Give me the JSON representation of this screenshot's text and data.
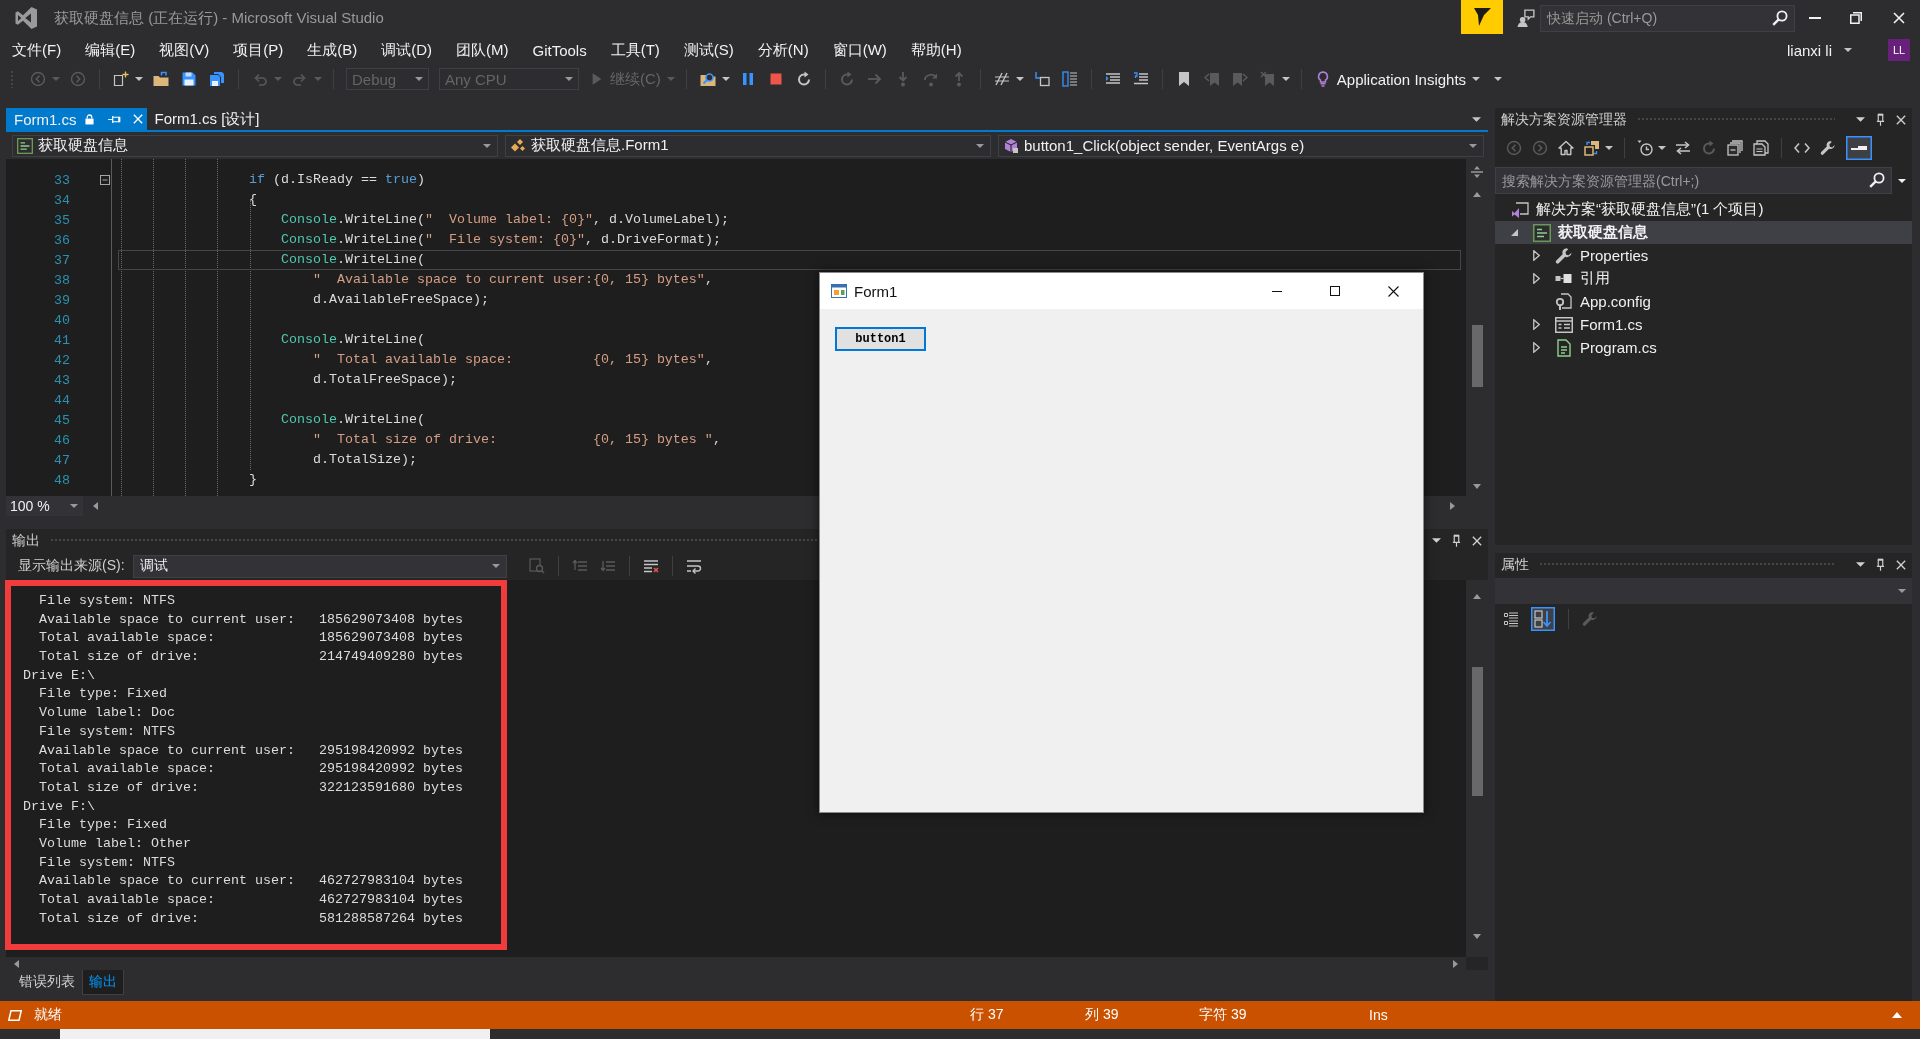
{
  "title_bar": {
    "title": "获取硬盘信息 (正在运行) - Microsoft Visual Studio",
    "quick_launch": {
      "placeholder": "快速启动 (Ctrl+Q)"
    }
  },
  "menu": [
    "文件(F)",
    "编辑(E)",
    "视图(V)",
    "项目(P)",
    "生成(B)",
    "调试(D)",
    "团队(M)",
    "GitTools",
    "工具(T)",
    "测试(S)",
    "分析(N)",
    "窗口(W)",
    "帮助(H)"
  ],
  "account": {
    "name": "lianxi li",
    "initials": "LL"
  },
  "toolbar": {
    "configuration": {
      "value": "Debug",
      "disabled": true
    },
    "platform": {
      "value": "Any CPU",
      "disabled": true
    },
    "continue": {
      "label": "继续(C)",
      "disabled": true
    },
    "insights": {
      "label": "Application Insights"
    }
  },
  "editor": {
    "tabs": [
      {
        "label": "Form1.cs",
        "selected": true
      },
      {
        "label": "Form1.cs [设计]",
        "selected": false
      }
    ],
    "navigation": [
      {
        "kind": "project",
        "label": "获取硬盘信息"
      },
      {
        "kind": "class",
        "label": "获取硬盘信息.Form1"
      },
      {
        "kind": "method",
        "label": "button1_Click(object sender, EventArgs e)"
      }
    ],
    "lines": [
      {
        "number": "33",
        "current": false,
        "folded": false,
        "tokens": [
          {
            "kind": "keyword",
            "text": "if"
          },
          {
            "kind": "plain",
            "text": " (d.IsReady == "
          },
          {
            "kind": "keyword",
            "text": "true"
          },
          {
            "kind": "plain",
            "text": ")"
          }
        ]
      },
      {
        "number": "34",
        "current": false,
        "tokens": [
          {
            "kind": "plain",
            "text": "{"
          }
        ],
        "children": [
          {
            "number": "35",
            "current": false,
            "tokens": [
              {
                "kind": "type",
                "text": "Console"
              },
              {
                "kind": "plain",
                "text": ".WriteLine("
              },
              {
                "kind": "string",
                "text": "\"  Volume label: {0}\""
              },
              {
                "kind": "plain",
                "text": ", d.VolumeLabel);"
              }
            ]
          },
          {
            "number": "36",
            "current": false,
            "tokens": [
              {
                "kind": "type",
                "text": "Console"
              },
              {
                "kind": "plain",
                "text": ".WriteLine("
              },
              {
                "kind": "string",
                "text": "\"  File system: {0}\""
              },
              {
                "kind": "plain",
                "text": ", d.DriveFormat);"
              }
            ]
          },
          {
            "number": "37",
            "current": true,
            "tokens": [
              {
                "kind": "type",
                "text": "Console"
              },
              {
                "kind": "plain",
                "text": ".WriteLine("
              }
            ],
            "children": [
              {
                "number": "38",
                "current": false,
                "tokens": [
                  {
                    "kind": "string",
                    "text": "\"  Available space to current user:{0, 15} bytes\""
                  },
                  {
                    "kind": "plain",
                    "text": ","
                  }
                ]
              },
              {
                "number": "39",
                "current": false,
                "tokens": [
                  {
                    "kind": "plain",
                    "text": "d.AvailableFreeSpace);"
                  }
                ]
              }
            ]
          },
          {
            "number": "40",
            "current": false
          },
          {
            "number": "41",
            "current": false,
            "tokens": [
              {
                "kind": "type",
                "text": "Console"
              },
              {
                "kind": "plain",
                "text": ".WriteLine("
              }
            ],
            "children": [
              {
                "number": "42",
                "current": false,
                "tokens": [
                  {
                    "kind": "string",
                    "text": "\"  Total available space:          {0, 15} bytes\""
                  },
                  {
                    "kind": "plain",
                    "text": ","
                  }
                ]
              },
              {
                "number": "43",
                "current": false,
                "tokens": [
                  {
                    "kind": "plain",
                    "text": "d.TotalFreeSpace);"
                  }
                ]
              }
            ]
          },
          {
            "number": "44",
            "current": false
          },
          {
            "number": "45",
            "current": false,
            "tokens": [
              {
                "kind": "type",
                "text": "Console"
              },
              {
                "kind": "plain",
                "text": ".WriteLine("
              }
            ],
            "children": [
              {
                "number": "46",
                "current": false,
                "tokens": [
                  {
                    "kind": "string",
                    "text": "\"  Total size of drive:            {0, 15} bytes \""
                  },
                  {
                    "kind": "plain",
                    "text": ","
                  }
                ]
              },
              {
                "number": "47",
                "current": false,
                "tokens": [
                  {
                    "kind": "plain",
                    "text": "d.TotalSize);"
                  }
                ]
              }
            ]
          }
        ]
      },
      {
        "number": "48",
        "current": false,
        "tokens": [
          {
            "kind": "plain",
            "text": "}"
          }
        ]
      }
    ],
    "zoom": "100 %"
  },
  "output": {
    "title": "输出",
    "source_label": "显示输出来源(S):",
    "source": "调试",
    "lines": [
      "  File system: NTFS",
      "  Available space to current user:   185629073408 bytes",
      "  Total available space:             185629073408 bytes",
      "  Total size of drive:               214749409280 bytes",
      "Drive E:\\",
      "  File type: Fixed",
      "  Volume label: Doc",
      "  File system: NTFS",
      "  Available space to current user:   295198420992 bytes",
      "  Total available space:             295198420992 bytes",
      "  Total size of drive:               322123591680 bytes",
      "Drive F:\\",
      "  File type: Fixed",
      "  Volume label: Other",
      "  File system: NTFS",
      "  Available space to current user:   462727983104 bytes",
      "  Total available space:             462727983104 bytes",
      "  Total size of drive:               581288587264 bytes"
    ]
  },
  "bottom_tabs": [
    {
      "label": "错误列表",
      "selected": false
    },
    {
      "label": "输出",
      "selected": true
    }
  ],
  "solution_explorer": {
    "title": "解决方案资源管理器",
    "search": {
      "placeholder": "搜索解决方案资源管理器(Ctrl+;)"
    },
    "tree": [
      {
        "label": "解决方案“获取硬盘信息”(1 个项目)",
        "kind": "solution",
        "expandable": false,
        "selected": false,
        "children": [
          {
            "label": "获取硬盘信息",
            "kind": "project",
            "expandable": true,
            "expanded": true,
            "selected": true,
            "children": [
              {
                "label": "Properties",
                "kind": "properties",
                "expandable": true,
                "expanded": false,
                "selected": false
              },
              {
                "label": "引用",
                "kind": "references",
                "expandable": true,
                "expanded": false,
                "selected": false
              },
              {
                "label": "App.config",
                "kind": "config",
                "expandable": false,
                "selected": false
              },
              {
                "label": "Form1.cs",
                "kind": "form",
                "expandable": true,
                "expanded": false,
                "selected": false
              },
              {
                "label": "Program.cs",
                "kind": "code",
                "expandable": true,
                "expanded": false,
                "selected": false
              }
            ]
          }
        ]
      }
    ]
  },
  "properties": {
    "title": "属性"
  },
  "form_window": {
    "title": "Form1",
    "button": "button1"
  },
  "status_bar": {
    "message": "就绪",
    "line": "行 37",
    "column": "列 39",
    "character": "字符 39",
    "mode": "Ins"
  }
}
